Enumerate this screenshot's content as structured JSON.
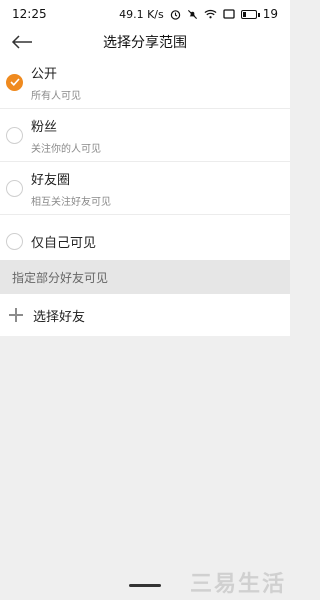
{
  "status_bar": {
    "time": "12:25",
    "network_speed": "49.1 K/s",
    "battery_level": "19",
    "icons": [
      "alarm-icon",
      "mute-icon",
      "wifi-icon",
      "screen-icon",
      "battery-icon"
    ]
  },
  "header": {
    "title": "选择分享范围",
    "back_icon": "back-arrow-icon"
  },
  "options": [
    {
      "label": "公开",
      "sub": "所有人可见",
      "checked": true
    },
    {
      "label": "粉丝",
      "sub": "关注你的人可见",
      "checked": false
    },
    {
      "label": "好友圈",
      "sub": "相互关注好友可见",
      "checked": false
    },
    {
      "label": "仅自己可见",
      "sub": "",
      "checked": false
    }
  ],
  "section": {
    "header": "指定部分好友可见",
    "select_label": "选择好友"
  },
  "accent_color": "#ef8a1f",
  "watermark": "三易生活"
}
